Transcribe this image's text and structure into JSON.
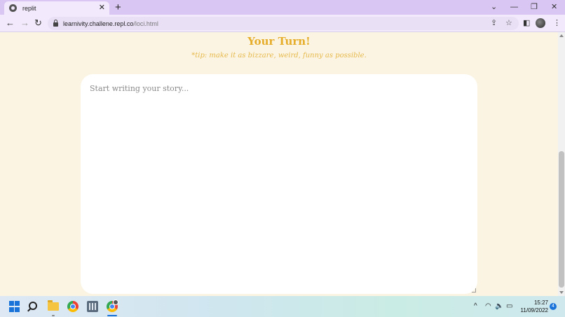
{
  "browser": {
    "tab_title": "replit",
    "tab_close": "✕",
    "new_tab": "+",
    "url_host": "learnivity.challene.repl.co",
    "url_path": "/loci.html",
    "window_controls": {
      "dropdown": "⌄",
      "minimize": "—",
      "restore": "❐",
      "close": "✕"
    }
  },
  "page": {
    "heading": "Your Turn!",
    "tip": "*tip: make it as bizzare, weird, funny as possible.",
    "story_placeholder": "Start writing your story..."
  },
  "taskbar": {
    "time": "15:27",
    "date": "11/09/2022",
    "notification_count": "4",
    "tray": {
      "chevron": "^",
      "wifi": "◠",
      "volume": "🔈",
      "battery": "▭"
    }
  },
  "colors": {
    "page_bg": "#fbf4e3",
    "heading": "#e6ad2a",
    "tip": "#e6b94a",
    "tab_strip": "#d9c6f2",
    "accent": "#1a73d9"
  }
}
